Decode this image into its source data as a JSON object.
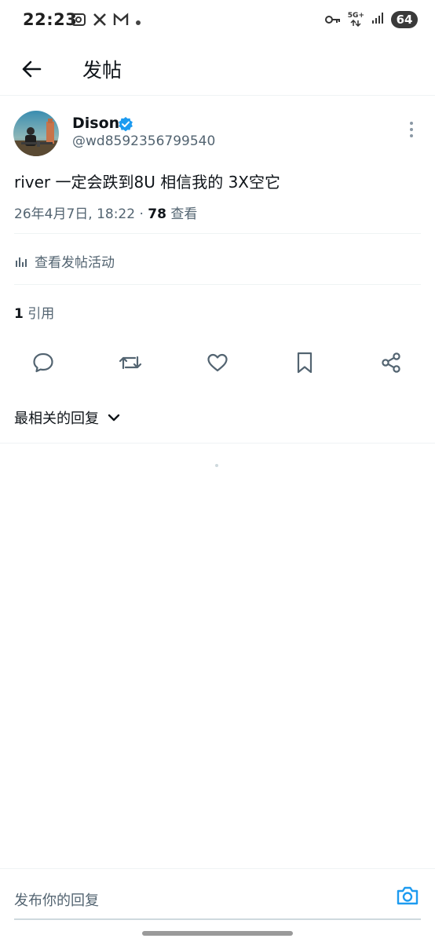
{
  "status_bar": {
    "time": "22:23",
    "network": "5G+",
    "battery": "64",
    "left_icons": [
      "screenshot-icon",
      "x-icon",
      "gmail-icon",
      "dot-icon"
    ],
    "right_icons": [
      "key-icon",
      "network-arrows-icon",
      "signal-icon",
      "battery-icon"
    ]
  },
  "header": {
    "title": "发帖"
  },
  "post": {
    "author_name": "Dison",
    "handle": "@wd8592356799540",
    "text": "river 一定会跌到8U 相信我的 3X空它",
    "date": "26年4月7日, 18:22 · ",
    "views_count": "78",
    "views_label": " 查看"
  },
  "activity": {
    "label": "查看发帖活动"
  },
  "quotes": {
    "count": "1",
    "label": " 引用"
  },
  "sort": {
    "label": "最相关的回复"
  },
  "composer": {
    "placeholder": "发布你的回复"
  },
  "colors": {
    "accent": "#1d9bf0",
    "text_primary": "#0f1419",
    "text_secondary": "#536471",
    "divider": "#eff3f4"
  }
}
